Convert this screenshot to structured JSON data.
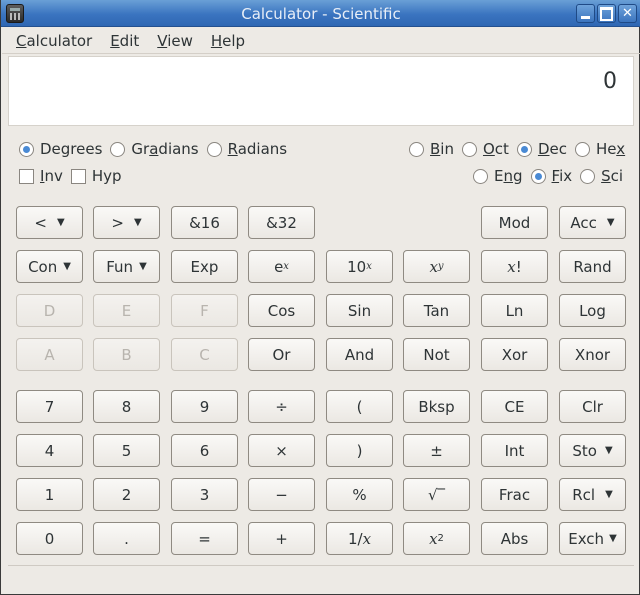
{
  "window": {
    "title": "Calculator  - Scientific",
    "icon": "calculator-icon",
    "controls": [
      "minimize-icon",
      "maximize-icon",
      "close-icon"
    ]
  },
  "menu": [
    {
      "label": "Calculator",
      "mnemonic": "C"
    },
    {
      "label": "Edit",
      "mnemonic": "E"
    },
    {
      "label": "View",
      "mnemonic": "V"
    },
    {
      "label": "Help",
      "mnemonic": "H"
    }
  ],
  "display": {
    "value": "0"
  },
  "angle_units": {
    "options": [
      "Degrees",
      "Gradians",
      "Radians"
    ],
    "selected": "Degrees"
  },
  "modifiers": [
    {
      "label": "Inv",
      "checked": false
    },
    {
      "label": "Hyp",
      "checked": false
    }
  ],
  "base": {
    "options": [
      "Bin",
      "Oct",
      "Dec",
      "Hex"
    ],
    "selected": "Dec"
  },
  "notation": {
    "options": [
      "Eng",
      "Fix",
      "Sci"
    ],
    "selected": "Fix"
  },
  "buttons": {
    "row1": [
      "<",
      ">",
      "&16",
      "&32",
      "Mod",
      "Acc"
    ],
    "row2": [
      "Con",
      "Fun",
      "Exp",
      "e^x",
      "10^x",
      "x^y",
      "x!",
      "Rand"
    ],
    "row3": [
      "D",
      "E",
      "F",
      "Cos",
      "Sin",
      "Tan",
      "Ln",
      "Log"
    ],
    "row4": [
      "A",
      "B",
      "C",
      "Or",
      "And",
      "Not",
      "Xor",
      "Xnor"
    ],
    "row5": [
      "7",
      "8",
      "9",
      "÷",
      "(",
      "Bksp",
      "CE",
      "Clr"
    ],
    "row6": [
      "4",
      "5",
      "6",
      "×",
      ")",
      "±",
      "Int",
      "Sto"
    ],
    "row7": [
      "1",
      "2",
      "3",
      "−",
      "%",
      "√",
      "Frac",
      "Rcl"
    ],
    "row8": [
      "0",
      ".",
      "=",
      "+",
      "1/x",
      "x^2",
      "Abs",
      "Exch"
    ]
  },
  "labels": {
    "shift_left": "<",
    "shift_right": ">",
    "and16": "&16",
    "and32": "&32",
    "mod": "Mod",
    "acc": "Acc",
    "con": "Con",
    "fun": "Fun",
    "exp": "Exp",
    "e_base": "e",
    "ten_base": "10",
    "x_var": "x",
    "y_var": "y",
    "factorial": "x!",
    "rand": "Rand",
    "hex_d": "D",
    "hex_e": "E",
    "hex_f": "F",
    "hex_a": "A",
    "hex_b": "B",
    "hex_c": "C",
    "cos": "Cos",
    "sin": "Sin",
    "tan": "Tan",
    "ln": "Ln",
    "log": "Log",
    "or": "Or",
    "and": "And",
    "not": "Not",
    "xor": "Xor",
    "xnor": "Xnor",
    "d7": "7",
    "d8": "8",
    "d9": "9",
    "div": "÷",
    "lparen": "(",
    "bksp": "Bksp",
    "ce": "CE",
    "clr": "Clr",
    "d4": "4",
    "d5": "5",
    "d6": "6",
    "mul": "×",
    "rparen": ")",
    "plusminus": "±",
    "int": "Int",
    "sto": "Sto",
    "d1": "1",
    "d2": "2",
    "d3": "3",
    "sub": "−",
    "percent": "%",
    "sqrt": "√‾",
    "frac": "Frac",
    "rcl": "Rcl",
    "d0": "0",
    "dot": ".",
    "eq": "=",
    "add": "+",
    "recip_num": "1/",
    "sq_exp": "2",
    "abs": "Abs",
    "exch": "Exch",
    "exp_x": "x",
    "exp_y": "y"
  },
  "disabled_buttons": [
    "D",
    "E",
    "F",
    "A",
    "B",
    "C"
  ]
}
